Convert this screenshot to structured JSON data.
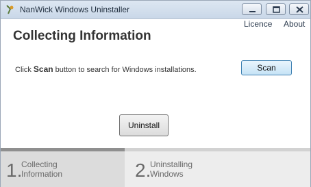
{
  "window": {
    "title": "NanWick Windows Uninstaller",
    "icon": "uninstaller-icon"
  },
  "title_controls": {
    "minimize_icon": "minimize-icon",
    "maximize_icon": "maximize-icon",
    "close_icon": "close-icon"
  },
  "links": {
    "licence": "Licence",
    "about": "About"
  },
  "main": {
    "heading": "Collecting Information",
    "instruction_prefix": "Click",
    "instruction_bold": "Scan",
    "instruction_suffix": "button to search for Windows installations.",
    "scan_button": "Scan",
    "uninstall_button": "Uninstall"
  },
  "steps": [
    {
      "number": "1.",
      "line1": "Collecting",
      "line2": "Information",
      "active": true
    },
    {
      "number": "2.",
      "line1": "Uninstalling",
      "line2": "Windows",
      "active": false
    }
  ],
  "colors": {
    "titlebar": "#c9d7e8",
    "active_step_bar": "#8f8f8f",
    "active_step_bg": "#dcdcdc"
  }
}
